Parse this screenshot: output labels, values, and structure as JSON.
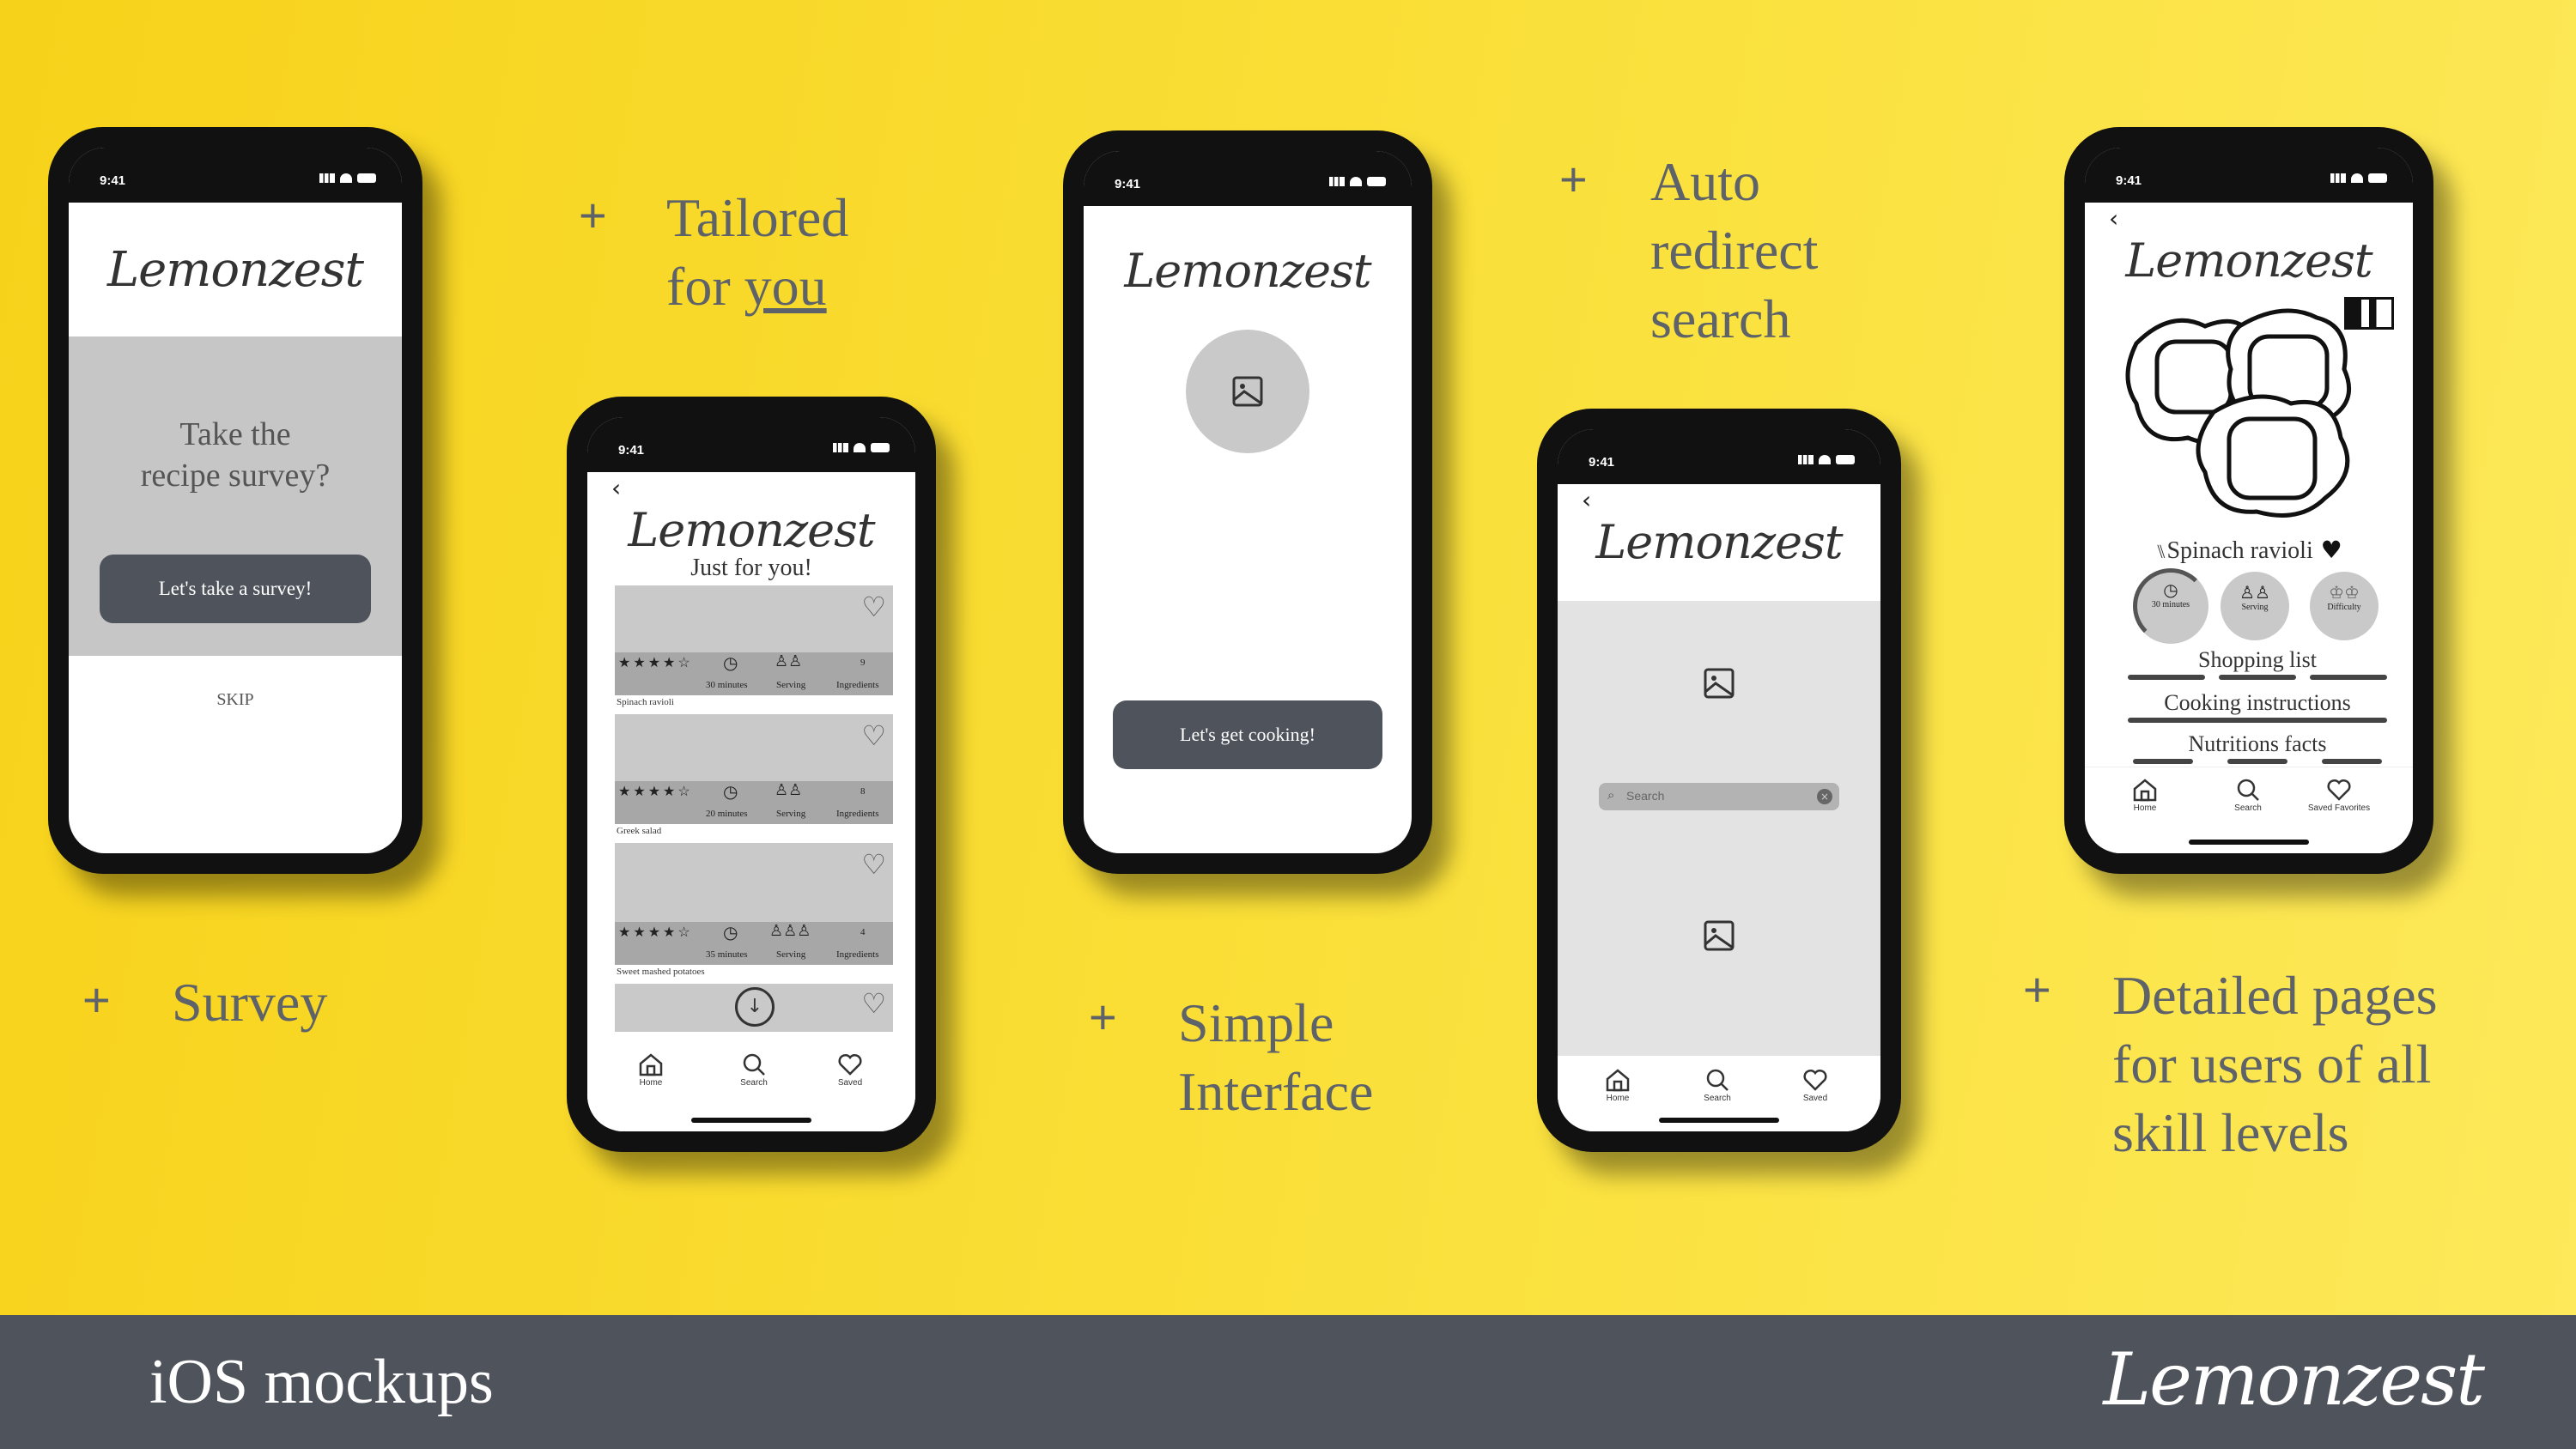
{
  "slide": {
    "footer_title": "iOS mockups",
    "footer_logo": "Lemonzest"
  },
  "captions": {
    "survey": {
      "plus": "+",
      "text": "Survey"
    },
    "tailored": {
      "plus": "+",
      "line1": "Tailored",
      "line2_prefix": "for ",
      "line2_underlined": "you"
    },
    "simple": {
      "plus": "+",
      "line1": "Simple",
      "line2": "Interface"
    },
    "auto": {
      "plus": "+",
      "line1": "Auto",
      "line2": "redirect",
      "line3": "search"
    },
    "detailed": {
      "plus": "+",
      "line1": "Detailed pages",
      "line2": "for users of all",
      "line3": "skill levels"
    }
  },
  "status_time": "9:41",
  "phone1": {
    "logo": "Lemonzest",
    "prompt_line1": "Take the",
    "prompt_line2": "recipe survey?",
    "button": "Let's take a survey!",
    "skip": "SKIP"
  },
  "phone2": {
    "logo": "Lemonzest",
    "subtitle": "Just for you!",
    "cards": [
      {
        "stars": "★★★★☆",
        "time": "30 minutes",
        "serving": "Serving",
        "count": "9",
        "ingredients": "Ingredients",
        "title": "Spinach ravioli"
      },
      {
        "stars": "★★★★☆",
        "time": "20 minutes",
        "serving": "Serving",
        "count": "8",
        "ingredients": "Ingredients",
        "title": "Greek salad"
      },
      {
        "stars": "★★★★☆",
        "time": "35 minutes",
        "serving": "Serving",
        "count": "4",
        "ingredients": "Ingredients",
        "title": "Sweet mashed potatoes"
      }
    ],
    "tabs": {
      "home": "Home",
      "search": "Search",
      "saved": "Saved"
    }
  },
  "phone3": {
    "logo": "Lemonzest",
    "button": "Let's get cooking!"
  },
  "phone4": {
    "logo": "Lemonzest",
    "search_placeholder": "Search",
    "tabs": {
      "home": "Home",
      "search": "Search",
      "saved": "Saved"
    }
  },
  "phone5": {
    "logo": "Lemonzest",
    "recipe_name": "Spinach ravioli",
    "badges": {
      "time": "30 minutes",
      "serving": "Serving",
      "difficulty": "Difficulty"
    },
    "sections": [
      "Shopping list",
      "Cooking instructions",
      "Nutritions facts"
    ],
    "tabs": {
      "home": "Home",
      "search": "Search",
      "saved": "Saved Favorites"
    }
  },
  "colors": {
    "background": "#f9dc2e",
    "footer": "#4f535b",
    "button": "#4f545c",
    "caption": "#5e6269"
  }
}
